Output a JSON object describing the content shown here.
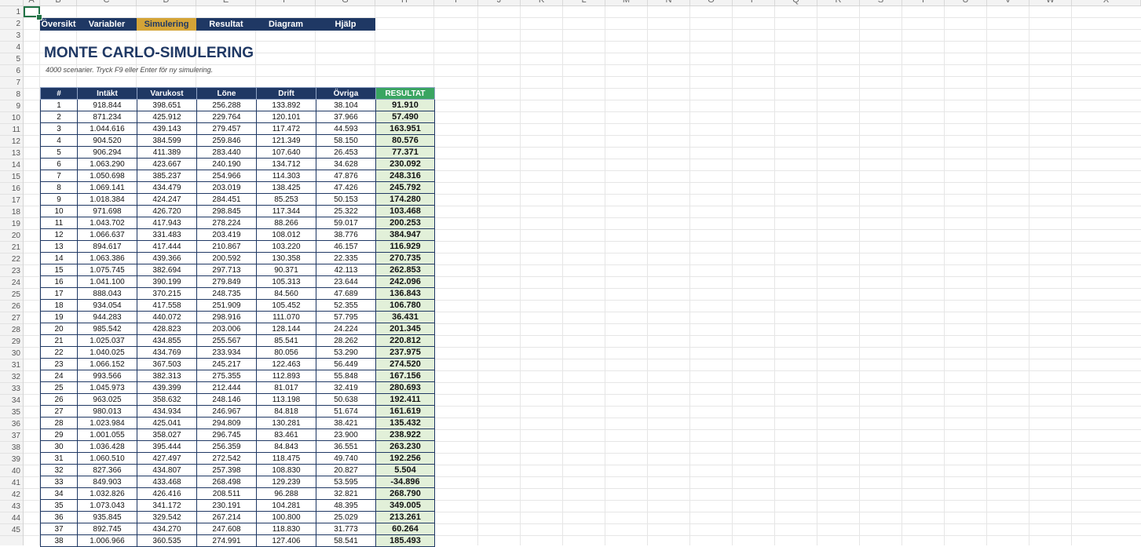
{
  "columns": [
    "A",
    "B",
    "C",
    "D",
    "E",
    "F",
    "G",
    "H",
    "I",
    "J",
    "K",
    "L",
    "M",
    "N",
    "O",
    "P",
    "Q",
    "R",
    "S",
    "T",
    "U",
    "V",
    "W",
    "X"
  ],
  "row_numbers": [
    "1",
    "2",
    "3",
    "4",
    "5",
    "6",
    "7",
    "8",
    "9",
    "10",
    "11",
    "12",
    "13",
    "14",
    "15",
    "16",
    "17",
    "18",
    "19",
    "20",
    "21",
    "22",
    "23",
    "24",
    "25",
    "26",
    "27",
    "28",
    "29",
    "30",
    "31",
    "32",
    "33",
    "34",
    "35",
    "36",
    "37",
    "38",
    "39",
    "40",
    "41",
    "42",
    "43",
    "44",
    "45"
  ],
  "nav": {
    "tabs": [
      {
        "label": "Översikt",
        "active": false
      },
      {
        "label": "Variabler",
        "active": false
      },
      {
        "label": "Simulering",
        "active": true
      },
      {
        "label": "Resultat",
        "active": false
      },
      {
        "label": "Diagram",
        "active": false
      },
      {
        "label": "Hjälp",
        "active": false
      }
    ]
  },
  "header": {
    "title": "MONTE CARLO-SIMULERING",
    "subtitle": "4000 scenarier. Tryck F9 eller Enter för ny simulering."
  },
  "colors": {
    "navy": "#1f3864",
    "gold": "#d4a437",
    "green_header": "#3aa561",
    "green_cell": "#e2f0d9",
    "selection": "#217346"
  },
  "table": {
    "headers": [
      "#",
      "Intäkt",
      "Varukost",
      "Löne",
      "Drift",
      "Övriga",
      "RESULTAT"
    ],
    "rows": [
      [
        "1",
        "918.844",
        "398.651",
        "256.288",
        "133.892",
        "38.104",
        "91.910"
      ],
      [
        "2",
        "871.234",
        "425.912",
        "229.764",
        "120.101",
        "37.966",
        "57.490"
      ],
      [
        "3",
        "1.044.616",
        "439.143",
        "279.457",
        "117.472",
        "44.593",
        "163.951"
      ],
      [
        "4",
        "904.520",
        "384.599",
        "259.846",
        "121.349",
        "58.150",
        "80.576"
      ],
      [
        "5",
        "906.294",
        "411.389",
        "283.440",
        "107.640",
        "26.453",
        "77.371"
      ],
      [
        "6",
        "1.063.290",
        "423.667",
        "240.190",
        "134.712",
        "34.628",
        "230.092"
      ],
      [
        "7",
        "1.050.698",
        "385.237",
        "254.966",
        "114.303",
        "47.876",
        "248.316"
      ],
      [
        "8",
        "1.069.141",
        "434.479",
        "203.019",
        "138.425",
        "47.426",
        "245.792"
      ],
      [
        "9",
        "1.018.384",
        "424.247",
        "284.451",
        "85.253",
        "50.153",
        "174.280"
      ],
      [
        "10",
        "971.698",
        "426.720",
        "298.845",
        "117.344",
        "25.322",
        "103.468"
      ],
      [
        "11",
        "1.043.702",
        "417.943",
        "278.224",
        "88.266",
        "59.017",
        "200.253"
      ],
      [
        "12",
        "1.066.637",
        "331.483",
        "203.419",
        "108.012",
        "38.776",
        "384.947"
      ],
      [
        "13",
        "894.617",
        "417.444",
        "210.867",
        "103.220",
        "46.157",
        "116.929"
      ],
      [
        "14",
        "1.063.386",
        "439.366",
        "200.592",
        "130.358",
        "22.335",
        "270.735"
      ],
      [
        "15",
        "1.075.745",
        "382.694",
        "297.713",
        "90.371",
        "42.113",
        "262.853"
      ],
      [
        "16",
        "1.041.100",
        "390.199",
        "279.849",
        "105.313",
        "23.644",
        "242.096"
      ],
      [
        "17",
        "888.043",
        "370.215",
        "248.735",
        "84.560",
        "47.689",
        "136.843"
      ],
      [
        "18",
        "934.054",
        "417.558",
        "251.909",
        "105.452",
        "52.355",
        "106.780"
      ],
      [
        "19",
        "944.283",
        "440.072",
        "298.916",
        "111.070",
        "57.795",
        "36.431"
      ],
      [
        "20",
        "985.542",
        "428.823",
        "203.006",
        "128.144",
        "24.224",
        "201.345"
      ],
      [
        "21",
        "1.025.037",
        "434.855",
        "255.567",
        "85.541",
        "28.262",
        "220.812"
      ],
      [
        "22",
        "1.040.025",
        "434.769",
        "233.934",
        "80.056",
        "53.290",
        "237.975"
      ],
      [
        "23",
        "1.066.152",
        "367.503",
        "245.217",
        "122.463",
        "56.449",
        "274.520"
      ],
      [
        "24",
        "993.566",
        "382.313",
        "275.355",
        "112.893",
        "55.848",
        "167.156"
      ],
      [
        "25",
        "1.045.973",
        "439.399",
        "212.444",
        "81.017",
        "32.419",
        "280.693"
      ],
      [
        "26",
        "963.025",
        "358.632",
        "248.146",
        "113.198",
        "50.638",
        "192.411"
      ],
      [
        "27",
        "980.013",
        "434.934",
        "246.967",
        "84.818",
        "51.674",
        "161.619"
      ],
      [
        "28",
        "1.023.984",
        "425.041",
        "294.809",
        "130.281",
        "38.421",
        "135.432"
      ],
      [
        "29",
        "1.001.055",
        "358.027",
        "296.745",
        "83.461",
        "23.900",
        "238.922"
      ],
      [
        "30",
        "1.036.428",
        "395.444",
        "256.359",
        "84.843",
        "36.551",
        "263.230"
      ],
      [
        "31",
        "1.060.510",
        "427.497",
        "272.542",
        "118.475",
        "49.740",
        "192.256"
      ],
      [
        "32",
        "827.366",
        "434.807",
        "257.398",
        "108.830",
        "20.827",
        "5.504"
      ],
      [
        "33",
        "849.903",
        "433.468",
        "268.498",
        "129.239",
        "53.595",
        "-34.896"
      ],
      [
        "34",
        "1.032.826",
        "426.416",
        "208.511",
        "96.288",
        "32.821",
        "268.790"
      ],
      [
        "35",
        "1.073.043",
        "341.172",
        "230.191",
        "104.281",
        "48.395",
        "349.005"
      ],
      [
        "36",
        "935.845",
        "329.542",
        "267.214",
        "100.800",
        "25.029",
        "213.261"
      ],
      [
        "37",
        "892.745",
        "434.270",
        "247.608",
        "118.830",
        "31.773",
        "60.264"
      ],
      [
        "38",
        "1.006.966",
        "360.535",
        "274.991",
        "127.406",
        "58.541",
        "185.493"
      ]
    ]
  }
}
